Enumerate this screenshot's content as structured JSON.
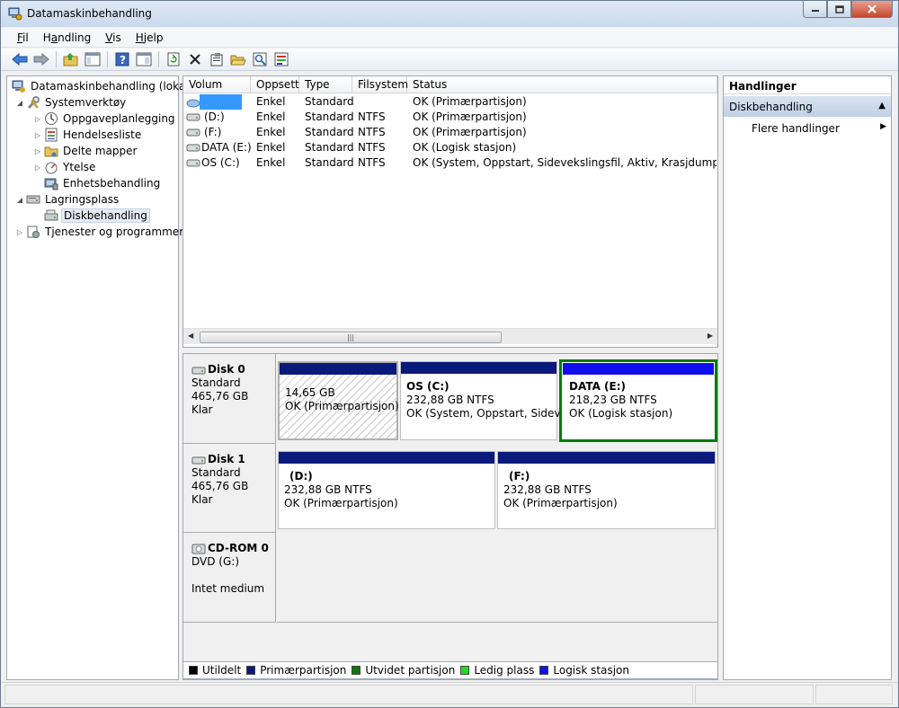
{
  "window": {
    "title": "Datamaskinbehandling"
  },
  "menu": [
    {
      "label": "Fil",
      "key": "F",
      "rest": "il"
    },
    {
      "label": "Handling",
      "key": "a",
      "pre": "H",
      "rest": "ndling"
    },
    {
      "label": "Vis",
      "key": "V",
      "rest": "is"
    },
    {
      "label": "Hjelp",
      "key": "H",
      "rest": "jelp"
    }
  ],
  "toolbar": [
    "back-icon",
    "forward-icon",
    "up-folder-icon",
    "show-tree-icon",
    "help-icon",
    "console-icon",
    "refresh-icon",
    "delete-icon",
    "properties-icon",
    "open-icon",
    "search-icon",
    "settings-icon"
  ],
  "tree": {
    "root": "Datamaskinbehandling (lokal)",
    "system_tools": "Systemverktøy",
    "task_scheduler": "Oppgaveplanlegging",
    "event_viewer": "Hendelsesliste",
    "shared_folders": "Delte mapper",
    "performance": "Ytelse",
    "device_manager": "Enhetsbehandling",
    "storage": "Lagringsplass",
    "disk_management": "Diskbehandling",
    "services": "Tjenester og programmer"
  },
  "volumes": {
    "columns": [
      "Volum",
      "Oppsett",
      "Type",
      "Filsystem",
      "Status"
    ],
    "rows": [
      {
        "vol": "",
        "layout": "Enkel",
        "type": "Standard",
        "fs": "",
        "status": "OK (Primærpartisjon)"
      },
      {
        "vol": "(D:)",
        "layout": "Enkel",
        "type": "Standard",
        "fs": "NTFS",
        "status": "OK (Primærpartisjon)"
      },
      {
        "vol": "(F:)",
        "layout": "Enkel",
        "type": "Standard",
        "fs": "NTFS",
        "status": "OK (Primærpartisjon)"
      },
      {
        "vol": "DATA (E:)",
        "layout": "Enkel",
        "type": "Standard",
        "fs": "NTFS",
        "status": "OK (Logisk stasjon)"
      },
      {
        "vol": "OS (C:)",
        "layout": "Enkel",
        "type": "Standard",
        "fs": "NTFS",
        "status": "OK (System, Oppstart, Sidevekslingsfil, Aktiv, Krasjdump, Primær"
      }
    ]
  },
  "disks": {
    "disk0": {
      "name": "Disk 0",
      "kind": "Standard",
      "size": "465,76 GB",
      "state": "Klar",
      "p1": {
        "size": "14,65 GB",
        "status": "OK (Primærpartisjon)"
      },
      "p2": {
        "name": "OS  (C:)",
        "size": "232,88 GB NTFS",
        "status": "OK (System, Oppstart, Sidevek"
      },
      "p3": {
        "name": "DATA  (E:)",
        "size": "218,23 GB NTFS",
        "status": "OK (Logisk stasjon)"
      }
    },
    "disk1": {
      "name": "Disk 1",
      "kind": "Standard",
      "size": "465,76 GB",
      "state": "Klar",
      "p1": {
        "name": "(D:)",
        "size": "232,88 GB NTFS",
        "status": "OK (Primærpartisjon)"
      },
      "p2": {
        "name": "(F:)",
        "size": "232,88 GB NTFS",
        "status": "OK (Primærpartisjon)"
      }
    },
    "cdrom": {
      "name": "CD-ROM 0",
      "drive": "DVD (G:)",
      "state": "Intet medium"
    }
  },
  "legend": [
    {
      "label": "Utildelt",
      "color": "#000000"
    },
    {
      "label": "Primærpartisjon",
      "color": "#0a1a7a"
    },
    {
      "label": "Utvidet partisjon",
      "color": "#0a7a0a"
    },
    {
      "label": "Ledig plass",
      "color": "#22dd22"
    },
    {
      "label": "Logisk stasjon",
      "color": "#1010ee"
    }
  ],
  "actions": {
    "header": "Handlinger",
    "section": "Diskbehandling",
    "more": "Flere handlinger"
  },
  "colors": {
    "primary": "#0a1a7a",
    "logical": "#1010ee",
    "selected_border": "#0a7a0a"
  }
}
